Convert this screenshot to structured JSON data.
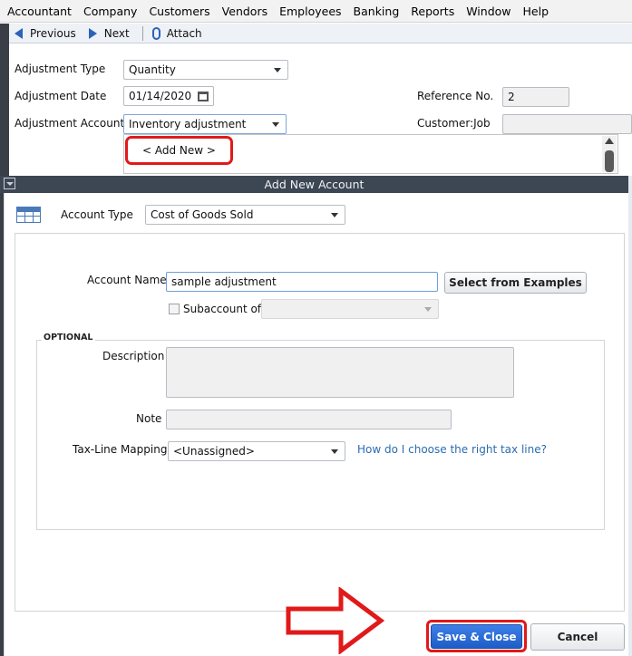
{
  "menu": [
    "Accountant",
    "Company",
    "Customers",
    "Vendors",
    "Employees",
    "Banking",
    "Reports",
    "Window",
    "Help"
  ],
  "toolbar": {
    "previous": "Previous",
    "next": "Next",
    "attach": "Attach"
  },
  "form": {
    "adjustment_type_label": "Adjustment Type",
    "adjustment_type_value": "Quantity",
    "adjustment_date_label": "Adjustment Date",
    "adjustment_date_value": "01/14/2020",
    "adjustment_account_label": "Adjustment Account",
    "adjustment_account_value": "Inventory adjustment",
    "reference_label": "Reference No.",
    "reference_value": "2",
    "customer_job_label": "Customer:Job",
    "dropdown_add_new": "< Add New >"
  },
  "dialog": {
    "title": "Add New Account",
    "account_type_label": "Account Type",
    "account_type_value": "Cost of Goods Sold",
    "account_name_label": "Account Name",
    "account_name_value": "sample adjustment",
    "select_examples": "Select from Examples",
    "subaccount_label": "Subaccount of",
    "optional_label": "OPTIONAL",
    "description_label": "Description",
    "note_label": "Note",
    "tax_line_label": "Tax-Line Mapping",
    "tax_line_value": "<Unassigned>",
    "tax_help_link": "How do I choose the right tax line?",
    "save_close": "Save & Close",
    "cancel": "Cancel"
  },
  "colors": {
    "highlight": "#e01a1a",
    "title_bar": "#3d4653",
    "primary_button": "#2a66d6",
    "link": "#2b6cb0"
  }
}
